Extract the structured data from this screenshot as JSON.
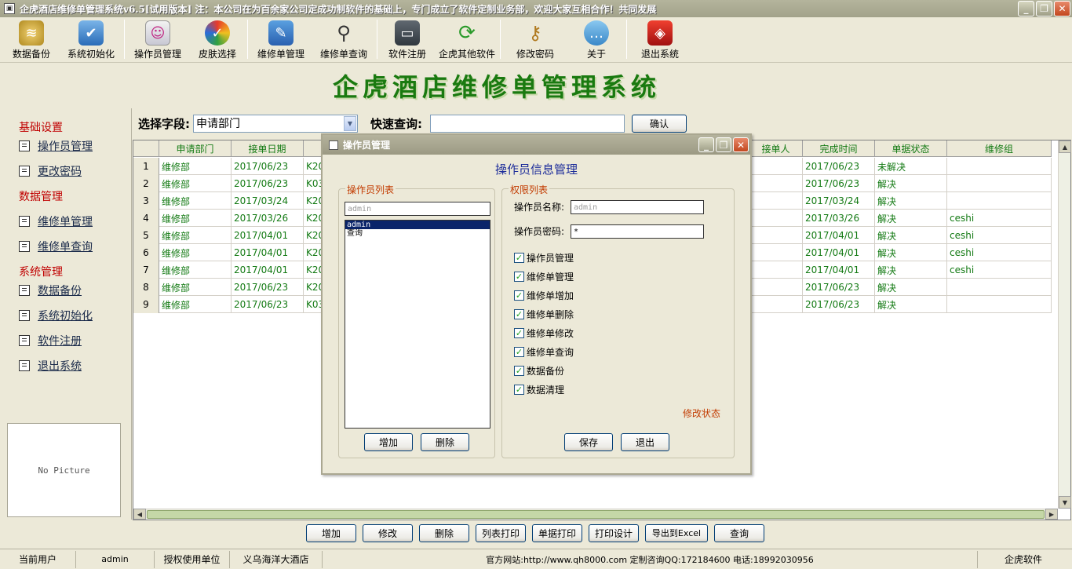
{
  "window": {
    "title": "企虎酒店维修单管理系统v6.5[试用版本] 注：本公司在为百余家公司定成功制软件的基础上，专门成立了软件定制业务部，欢迎大家互相合作！共同发展"
  },
  "toolbar": [
    {
      "label": "数据备份",
      "icon": "database-icon"
    },
    {
      "label": "系统初始化",
      "icon": "document-check-icon"
    },
    {
      "label": "操作员管理",
      "icon": "operator-icon"
    },
    {
      "label": "皮肤选择",
      "icon": "skin-icon"
    },
    {
      "label": "维修单管理",
      "icon": "edit-book-icon"
    },
    {
      "label": "维修单查询",
      "icon": "magnifier-icon"
    },
    {
      "label": "软件注册",
      "icon": "monitor-register-icon"
    },
    {
      "label": "企虎其他软件",
      "icon": "refresh-icon"
    },
    {
      "label": "修改密码",
      "icon": "key-icon"
    },
    {
      "label": "关于",
      "icon": "chat-bubble-icon"
    },
    {
      "label": "退出系统",
      "icon": "exit-cube-icon"
    }
  ],
  "banner": {
    "title": "企虎酒店维修单管理系统"
  },
  "sidebar": {
    "groups": [
      {
        "title": "基础设置",
        "items": [
          "操作员管理",
          "更改密码"
        ]
      },
      {
        "title": "数据管理",
        "items": [
          "维修单管理",
          "维修单查询"
        ]
      },
      {
        "title": "系统管理",
        "items": [
          "数据备份",
          "系统初始化",
          "软件注册",
          "退出系统"
        ]
      }
    ],
    "picture_placeholder": "No Picture"
  },
  "search": {
    "field_label": "选择字段:",
    "field_value": "申请部门",
    "quick_label": "快速查询:",
    "quick_value": "",
    "confirm": "确认"
  },
  "grid": {
    "columns": [
      "申请部门",
      "接单日期",
      "接单人",
      "完成时间",
      "单据状态",
      "维修组"
    ],
    "rows": [
      {
        "n": "1",
        "dept": "维修部",
        "date": "2017/06/23",
        "code": "K20",
        "done": "2017/06/23",
        "status": "未解决",
        "group": ""
      },
      {
        "n": "2",
        "dept": "维修部",
        "date": "2017/06/23",
        "code": "K03",
        "done": "2017/06/23",
        "status": "解决",
        "group": ""
      },
      {
        "n": "3",
        "dept": "维修部",
        "date": "2017/03/24",
        "code": "K20",
        "done": "2017/03/24",
        "status": "解决",
        "group": ""
      },
      {
        "n": "4",
        "dept": "维修部",
        "date": "2017/03/26",
        "code": "K20",
        "done": "2017/03/26",
        "status": "解决",
        "group": "ceshi"
      },
      {
        "n": "5",
        "dept": "维修部",
        "date": "2017/04/01",
        "code": "K20",
        "done": "2017/04/01",
        "status": "解决",
        "group": "ceshi"
      },
      {
        "n": "6",
        "dept": "维修部",
        "date": "2017/04/01",
        "code": "K20",
        "done": "2017/04/01",
        "status": "解决",
        "group": "ceshi"
      },
      {
        "n": "7",
        "dept": "维修部",
        "date": "2017/04/01",
        "code": "K20",
        "done": "2017/04/01",
        "status": "解决",
        "group": "ceshi"
      },
      {
        "n": "8",
        "dept": "维修部",
        "date": "2017/06/23",
        "code": "K20",
        "done": "2017/06/23",
        "status": "解决",
        "group": ""
      },
      {
        "n": "9",
        "dept": "维修部",
        "date": "2017/06/23",
        "code": "K03",
        "done": "2017/06/23",
        "status": "解决",
        "group": ""
      }
    ]
  },
  "bottom_buttons": [
    "增加",
    "修改",
    "删除",
    "列表打印",
    "单据打印",
    "打印设计",
    "导出到Excel",
    "查询"
  ],
  "status": {
    "user_label": "当前用户",
    "user": "admin",
    "unit_label": "授权使用单位",
    "unit": "义乌海洋大酒店",
    "site": "官方网站:http://www.qh8000.com 定制咨询QQ:172184600 电话:18992030956",
    "brand": "企虎软件"
  },
  "dialog": {
    "title": "操作员管理",
    "heading": "操作员信息管理",
    "list_legend": "操作员列表",
    "list_filter": "admin",
    "operators": [
      "admin",
      "查询"
    ],
    "add": "增加",
    "delete": "删除",
    "perm_legend": "权限列表",
    "name_label": "操作员名称:",
    "name_value": "admin",
    "pwd_label": "操作员密码:",
    "pwd_value": "*",
    "permissions": [
      "操作员管理",
      "维修单管理",
      "维修单增加",
      "维修单删除",
      "维修单修改",
      "维修单查询",
      "数据备份",
      "数据清理"
    ],
    "mode": "修改状态",
    "save": "保存",
    "exit": "退出"
  },
  "colors": {
    "accent_green": "#1a7a10",
    "mode_red": "#c23b00",
    "heading_blue": "#1c2c9a"
  }
}
